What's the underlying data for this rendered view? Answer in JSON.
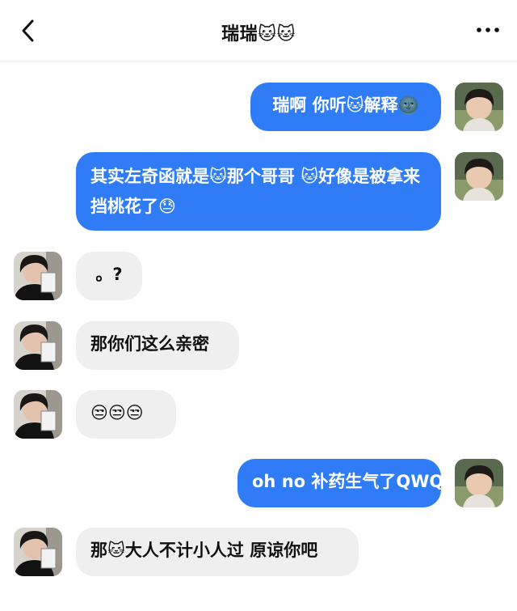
{
  "header": {
    "title": "瑞瑞🐱🐱"
  },
  "messages": [
    {
      "sender": "me",
      "text": "瑞啊 你听🐱解释🌚"
    },
    {
      "sender": "me",
      "text": "其实左奇函就是🐱那个哥哥 🐱好像是被拿来挡桃花了😓"
    },
    {
      "sender": "them",
      "text": "。?"
    },
    {
      "sender": "them",
      "text": "那你们这么亲密"
    },
    {
      "sender": "them",
      "text": "😒😒😒"
    },
    {
      "sender": "me",
      "text": "oh no 补药生气了QWQ"
    },
    {
      "sender": "them",
      "text": "那🐱大人不计小人过 原谅你吧"
    }
  ]
}
